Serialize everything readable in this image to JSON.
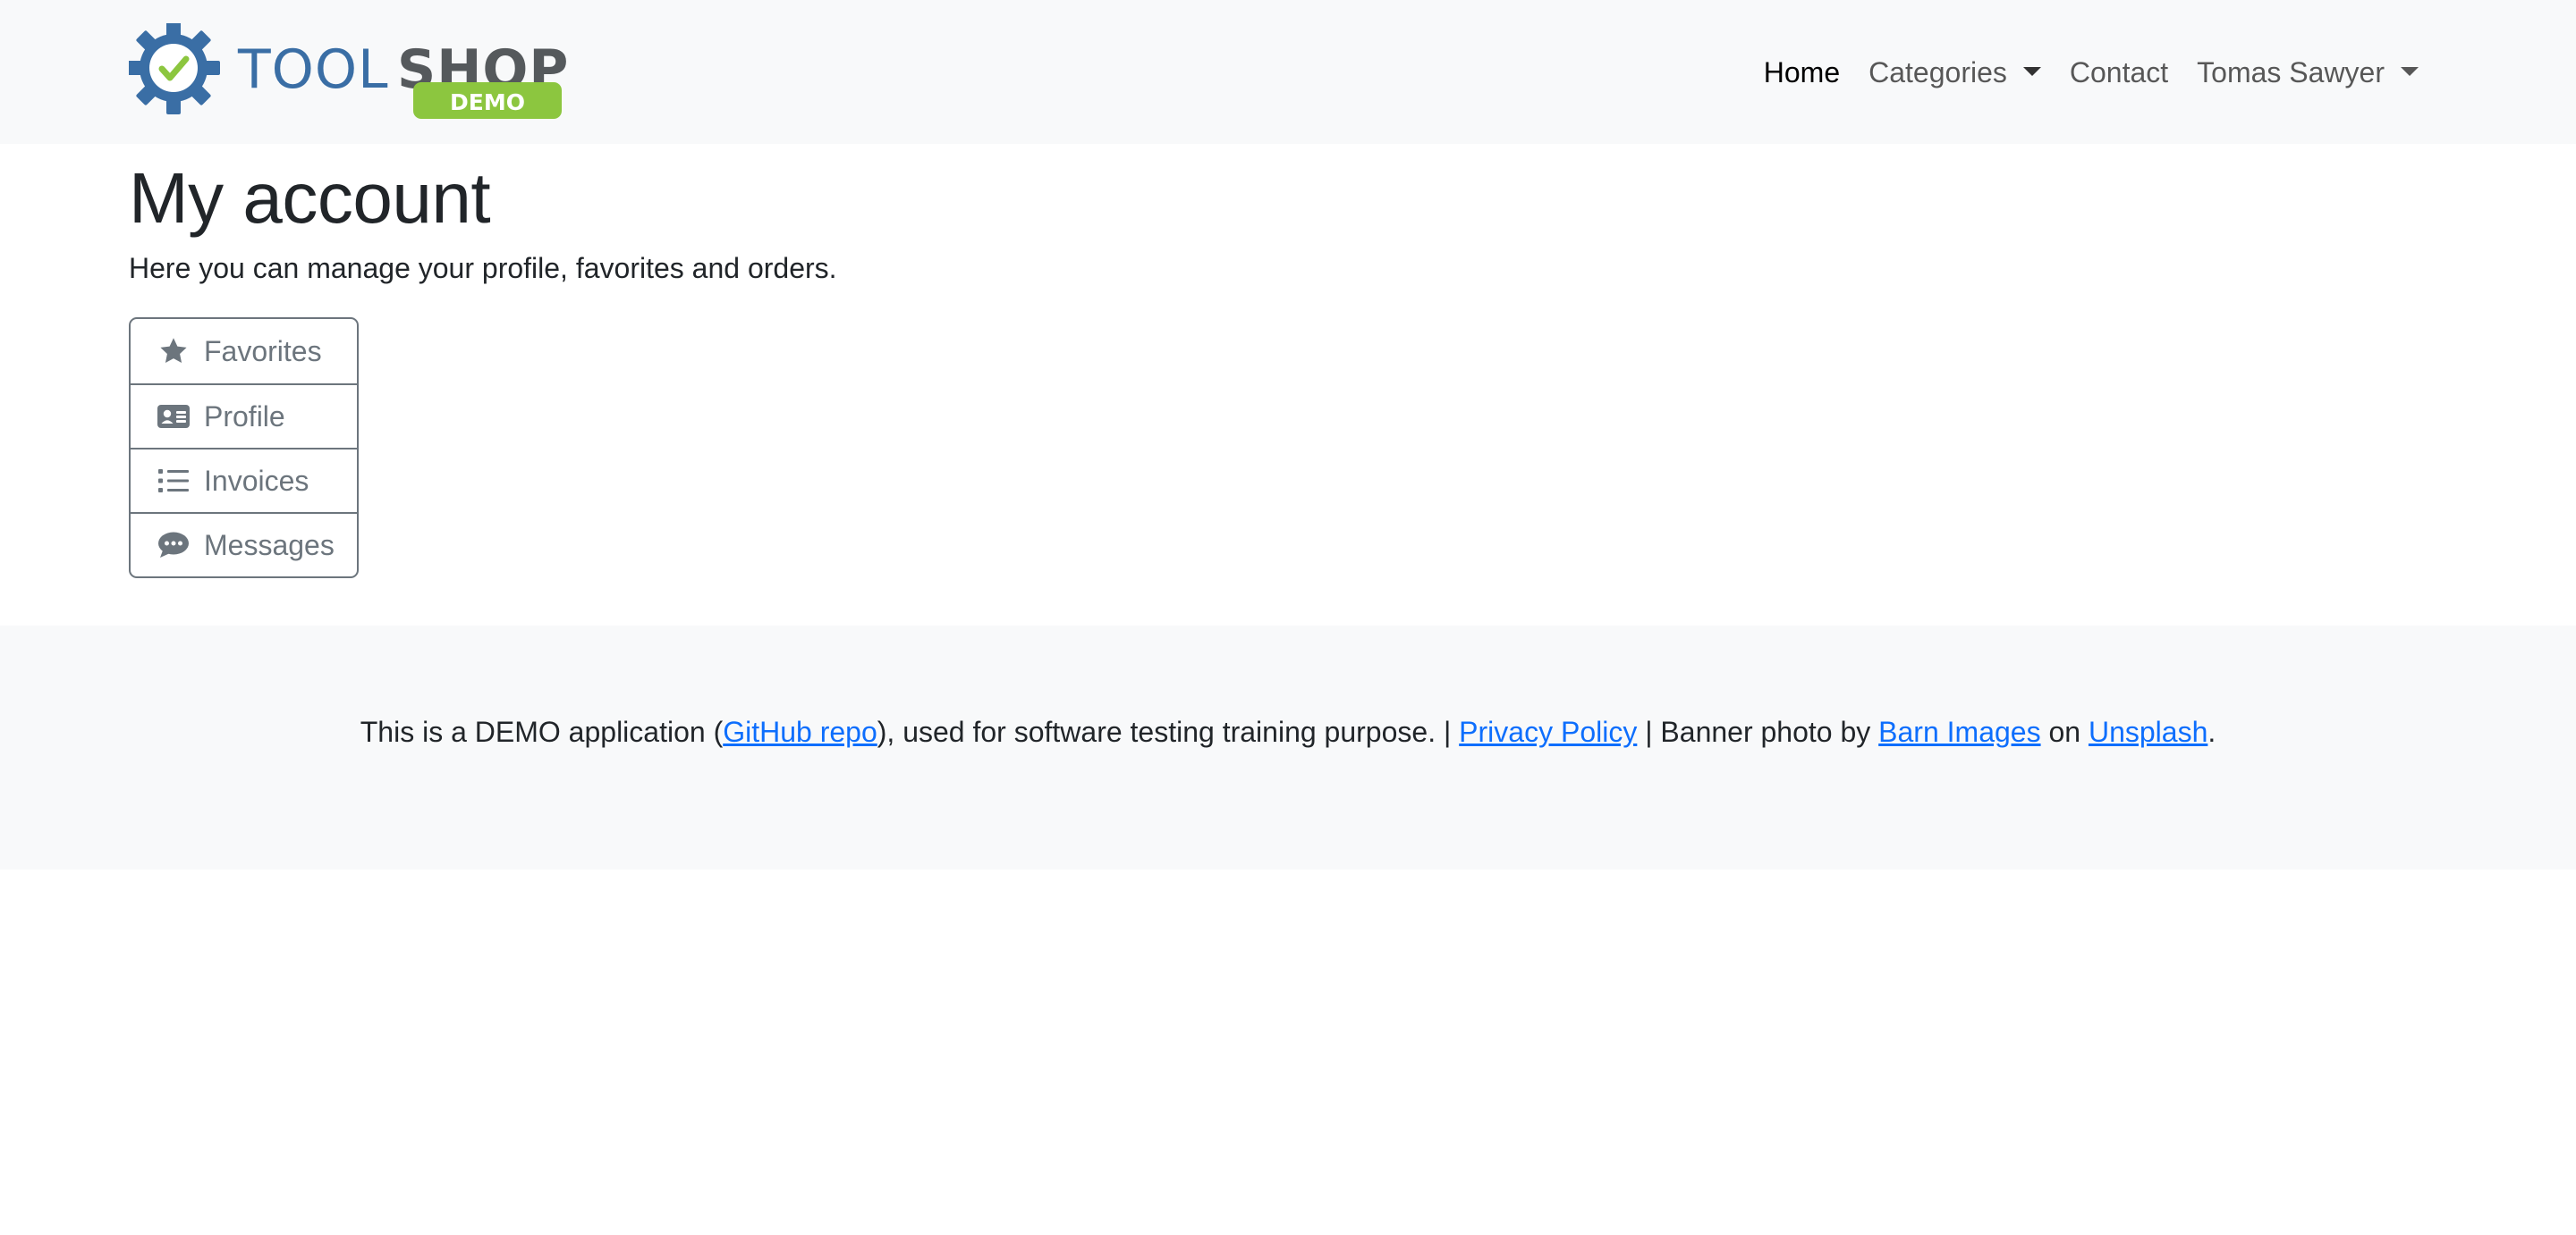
{
  "brand": {
    "logo_text_left": "TOOL",
    "logo_text_right": "SHOP",
    "logo_badge": "DEMO",
    "colors": {
      "blue": "#3a6ea5",
      "gray": "#55595c",
      "green": "#8cc63f"
    }
  },
  "nav": {
    "home": "Home",
    "categories": "Categories",
    "contact": "Contact",
    "user": "Tomas Sawyer"
  },
  "page": {
    "title": "My account",
    "subtitle": "Here you can manage your profile, favorites and orders."
  },
  "account_menu": [
    {
      "label": "Favorites",
      "icon": "star-icon"
    },
    {
      "label": "Profile",
      "icon": "id-card-icon"
    },
    {
      "label": "Invoices",
      "icon": "list-icon"
    },
    {
      "label": "Messages",
      "icon": "comments-icon"
    }
  ],
  "footer": {
    "part1": "This is a DEMO application (",
    "github_link": "GitHub repo",
    "part2": "), used for software testing training purpose. | ",
    "privacy_link": "Privacy Policy",
    "part3": " | Banner photo by ",
    "barn_link": "Barn Images",
    "part4": " on ",
    "unsplash_link": "Unsplash",
    "part5": "."
  },
  "colors": {
    "navbar_bg": "#f8f9fa",
    "link": "#0d6efd",
    "button_outline": "#6c757d"
  }
}
